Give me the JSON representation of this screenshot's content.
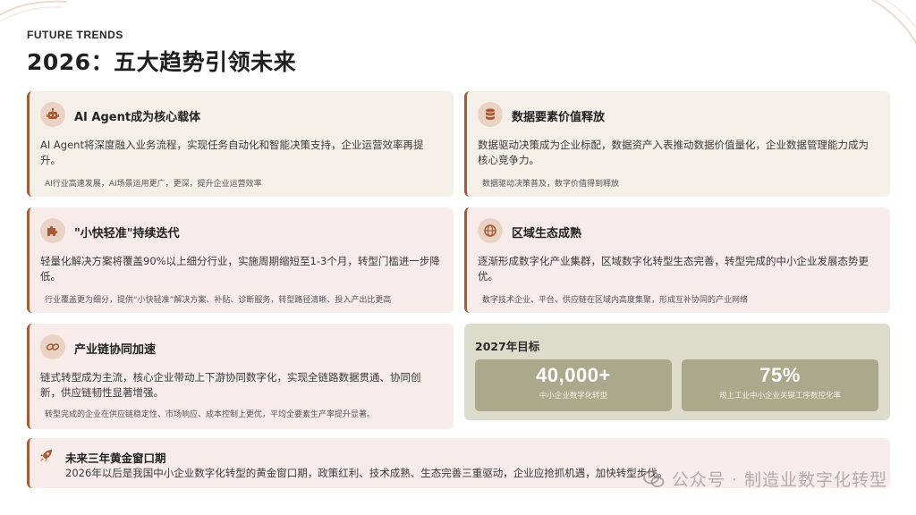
{
  "header": {
    "eyebrow": "FUTURE TRENDS",
    "title": "2026：五大趋势引领未来"
  },
  "cards": [
    {
      "icon": "robot-icon",
      "title": "AI Agent成为核心载体",
      "desc": "AI Agent将深度融入业务流程，实现任务自动化和智能决策支持，企业运营效率再提升。",
      "note": "AI行业高速发展，AI场景运用更广，更深，提升企业运营效率"
    },
    {
      "icon": "database-icon",
      "title": "数据要素价值释放",
      "desc": "数据驱动决策成为企业标配，数据资产入表推动数据价值量化，企业数据管理能力成为核心竞争力。",
      "note": "数据驱动决策普及，数字价值得到释放"
    },
    {
      "icon": "puzzle-icon",
      "title": "\"小快轻准\"持续迭代",
      "desc": "轻量化解决方案将覆盖90%以上细分行业，实施周期缩短至1-3个月，转型门槛进一步降低。",
      "note": "行业覆盖更为细分，提供“小快轻准”解决方案、补贴、诊断服务，转型路径清晰、投入产出比更高"
    },
    {
      "icon": "globe-icon",
      "title": "区域生态成熟",
      "desc": "逐渐形成数字化产业集群，区域数字化转型生态完善，转型完成的中小企业发展态势更优。",
      "note": "数字技术企业、平台、供应链在区域内高度集聚，形成互补协同的产业网络"
    },
    {
      "icon": "link-icon",
      "title": "产业链协同加速",
      "desc": "链式转型成为主流，核心企业带动上下游协同数字化，实现全链路数据贯通、协同创新，供应链韧性显著增强。",
      "note": "转型完成的企业在供应链稳定性、市场响应、成本控制上更优，平均全要素生产率提升显著。"
    }
  ],
  "goals": {
    "title": "2027年目标",
    "items": [
      {
        "value": "40,000+",
        "label": "中小企业数字化转型"
      },
      {
        "value": "75%",
        "label": "规上工业中小企业关键工序数控化率"
      }
    ]
  },
  "bottom": {
    "icon": "rocket-icon",
    "title": "未来三年黄金窗口期",
    "desc": "2026年以后是我国中小企业数字化转型的黄金窗口期，政策红利、技术成熟、生态完善三重驱动，企业应抢抓机遇，加快转型步伐。"
  },
  "watermark": {
    "icon": "wechat-icon",
    "text": "公众号 · 制造业数字化转型"
  },
  "colors": {
    "accent": "#a65b35",
    "card_beige": "#f5efe9",
    "card_pink": "#f7ecea",
    "goal_bg": "#dcdccb",
    "goal_box": "#a9a98b"
  }
}
